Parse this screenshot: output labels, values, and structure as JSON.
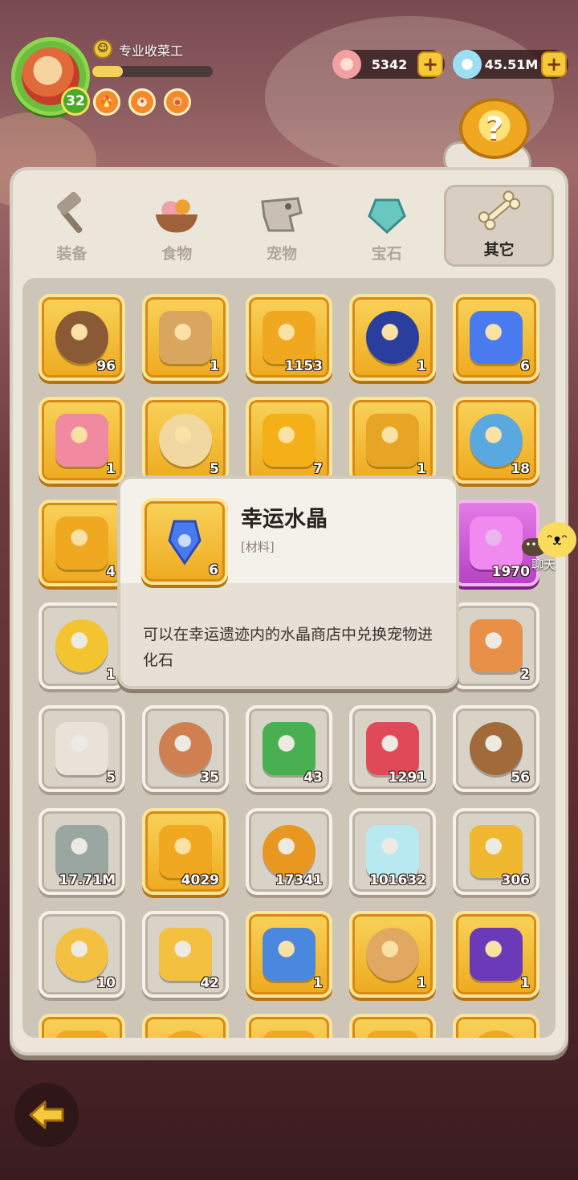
{
  "player": {
    "title": "专业收菜工",
    "level": "32",
    "xp_fraction": 0.25,
    "buffs": [
      "fire-badge",
      "strength-badge",
      "meat-badge"
    ]
  },
  "currencies": [
    {
      "name": "shell-gem",
      "value": "5342",
      "color": "#f2b0a8"
    },
    {
      "name": "crystal-clam",
      "value": "45.51M",
      "color": "#9cdff3"
    }
  ],
  "tabs": [
    {
      "label": "装备",
      "icon": "hammer-icon",
      "active": false
    },
    {
      "label": "食物",
      "icon": "food-bowl-icon",
      "active": false
    },
    {
      "label": "宠物",
      "icon": "pet-skull-icon",
      "active": false
    },
    {
      "label": "宝石",
      "icon": "gem-icon",
      "active": false
    },
    {
      "label": "其它",
      "icon": "bone-icon",
      "active": true
    }
  ],
  "items": [
    {
      "icon": "treasure-chest-icon",
      "count": "96",
      "rarity": "gold",
      "color": "#8a5a36"
    },
    {
      "icon": "backpack-icon",
      "count": "1",
      "rarity": "gold",
      "color": "#d9a660"
    },
    {
      "icon": "spiral-coin-icon",
      "count": "1153",
      "rarity": "gold",
      "color": "#f0a820"
    },
    {
      "icon": "sonic-card-icon",
      "count": "1",
      "rarity": "gold",
      "color": "#2a3e9e"
    },
    {
      "icon": "lucky-crystal-icon",
      "count": "6",
      "rarity": "gold",
      "color": "#4a7af0"
    },
    {
      "icon": "music-note-icon",
      "count": "1",
      "rarity": "gold",
      "color": "#f08aa0"
    },
    {
      "icon": "scroll-map-icon",
      "count": "5",
      "rarity": "gold",
      "color": "#f0d8a0"
    },
    {
      "icon": "golden-egg-icon",
      "count": "7",
      "rarity": "gold",
      "color": "#f4b018"
    },
    {
      "icon": "medal-icon",
      "count": "1",
      "rarity": "gold",
      "color": "#e8a424"
    },
    {
      "icon": "blue-ticket-icon",
      "count": "18",
      "rarity": "gold",
      "color": "#5aa8e0"
    },
    {
      "icon": "shell-coin-icon",
      "count": "4",
      "rarity": "gold",
      "color": "#f0a820"
    },
    {
      "icon": "hidden-slot",
      "count": "",
      "rarity": "gold",
      "color": "#f0a820"
    },
    {
      "icon": "hidden-slot",
      "count": "",
      "rarity": "gold",
      "color": "#f0a820"
    },
    {
      "icon": "hidden-slot",
      "count": "",
      "rarity": "gold",
      "color": "#f0a820"
    },
    {
      "icon": "pink-crystal-icon",
      "count": "1970",
      "rarity": "purple",
      "color": "#f08af0"
    },
    {
      "icon": "golden-rose-icon",
      "count": "1",
      "rarity": "gray",
      "color": "#f4c430"
    },
    {
      "icon": "hidden-slot",
      "count": "",
      "rarity": "gray",
      "color": "#bbb"
    },
    {
      "icon": "hidden-slot",
      "count": "",
      "rarity": "gray",
      "color": "#bbb"
    },
    {
      "icon": "hidden-slot",
      "count": "",
      "rarity": "gray",
      "color": "#bbb"
    },
    {
      "icon": "orange-scroll-icon",
      "count": "2",
      "rarity": "gray",
      "color": "#e89048"
    },
    {
      "icon": "dice-icon",
      "count": "5",
      "rarity": "gray",
      "color": "#e8e2d8"
    },
    {
      "icon": "paw-ticket-icon",
      "count": "35",
      "rarity": "gray",
      "color": "#d08050"
    },
    {
      "icon": "green-ticket-icon",
      "count": "43",
      "rarity": "gray",
      "color": "#48b050"
    },
    {
      "icon": "red-ticket-icon",
      "count": "1291",
      "rarity": "gray",
      "color": "#e04a58"
    },
    {
      "icon": "brown-ticket-icon",
      "count": "56",
      "rarity": "gray",
      "color": "#a06a3a"
    },
    {
      "icon": "spiral-stone-icon",
      "count": "17.71M",
      "rarity": "gray",
      "color": "#9aa6a0"
    },
    {
      "icon": "gold-rune-coin-icon",
      "count": "4029",
      "rarity": "gold",
      "color": "#f0a820"
    },
    {
      "icon": "beast-coin-icon",
      "count": "17341",
      "rarity": "gray",
      "color": "#e89820"
    },
    {
      "icon": "rainbow-gem-icon",
      "count": "101632",
      "rarity": "gray",
      "color": "#b8e8f0"
    },
    {
      "icon": "mask-chest-icon",
      "count": "306",
      "rarity": "gray",
      "color": "#f0b830"
    },
    {
      "icon": "crown-pie-icon",
      "count": "10",
      "rarity": "gray",
      "color": "#f4c040"
    },
    {
      "icon": "chick-pie-icon",
      "count": "42",
      "rarity": "gray",
      "color": "#f4c040"
    },
    {
      "icon": "sonic-photo-icon",
      "count": "1",
      "rarity": "gold",
      "color": "#4a88e0"
    },
    {
      "icon": "desert-photo-icon",
      "count": "1",
      "rarity": "gold",
      "color": "#e0a860"
    },
    {
      "icon": "neon-photo-icon",
      "count": "1",
      "rarity": "gold",
      "color": "#6a3ab8"
    },
    {
      "icon": "partial-item",
      "count": "",
      "rarity": "gold",
      "color": "#f0a820"
    },
    {
      "icon": "partial-item",
      "count": "",
      "rarity": "gold",
      "color": "#f0a820"
    },
    {
      "icon": "partial-item",
      "count": "",
      "rarity": "gold",
      "color": "#f0a820"
    },
    {
      "icon": "partial-item",
      "count": "",
      "rarity": "gold",
      "color": "#f0a820"
    },
    {
      "icon": "partial-item",
      "count": "",
      "rarity": "gold",
      "color": "#f0a820"
    }
  ],
  "tooltip": {
    "title": "幸运水晶",
    "type": "[材料]",
    "count": "6",
    "icon": "lucky-crystal-icon",
    "description": "可以在幸运遗迹内的水晶商店中兑换宠物进化石"
  },
  "chat": {
    "label": "聊天"
  },
  "colors": {
    "gold_slot": "#eeaa1e",
    "panel": "#ece6da",
    "accent": "#f5c93a"
  }
}
